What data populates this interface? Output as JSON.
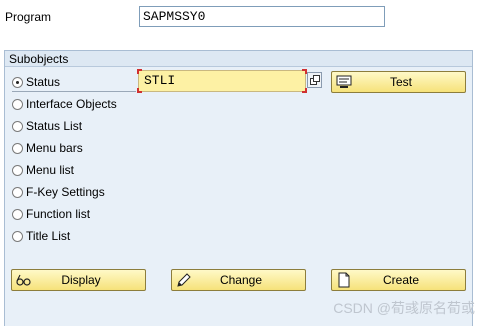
{
  "program": {
    "label": "Program",
    "value": "SAPMSSY0"
  },
  "subobjects": {
    "title": "Subobjects",
    "status_value": "STLI",
    "options": [
      {
        "label": "Status",
        "selected": true
      },
      {
        "label": "Interface Objects",
        "selected": false
      },
      {
        "label": "Status List",
        "selected": false
      },
      {
        "label": "Menu bars",
        "selected": false
      },
      {
        "label": "Menu list",
        "selected": false
      },
      {
        "label": "F-Key Settings",
        "selected": false
      },
      {
        "label": "Function list",
        "selected": false
      },
      {
        "label": "Title List",
        "selected": false
      }
    ]
  },
  "buttons": {
    "test": "Test",
    "display": "Display",
    "change": "Change",
    "create": "Create"
  },
  "watermark": "CSDN @荀彧原名荀或",
  "colors": {
    "field_required_bg": "#fdf1a4",
    "button_bg": "#f6e27a",
    "group_bg": "#e8f0f8",
    "required_marker": "#d03030"
  }
}
